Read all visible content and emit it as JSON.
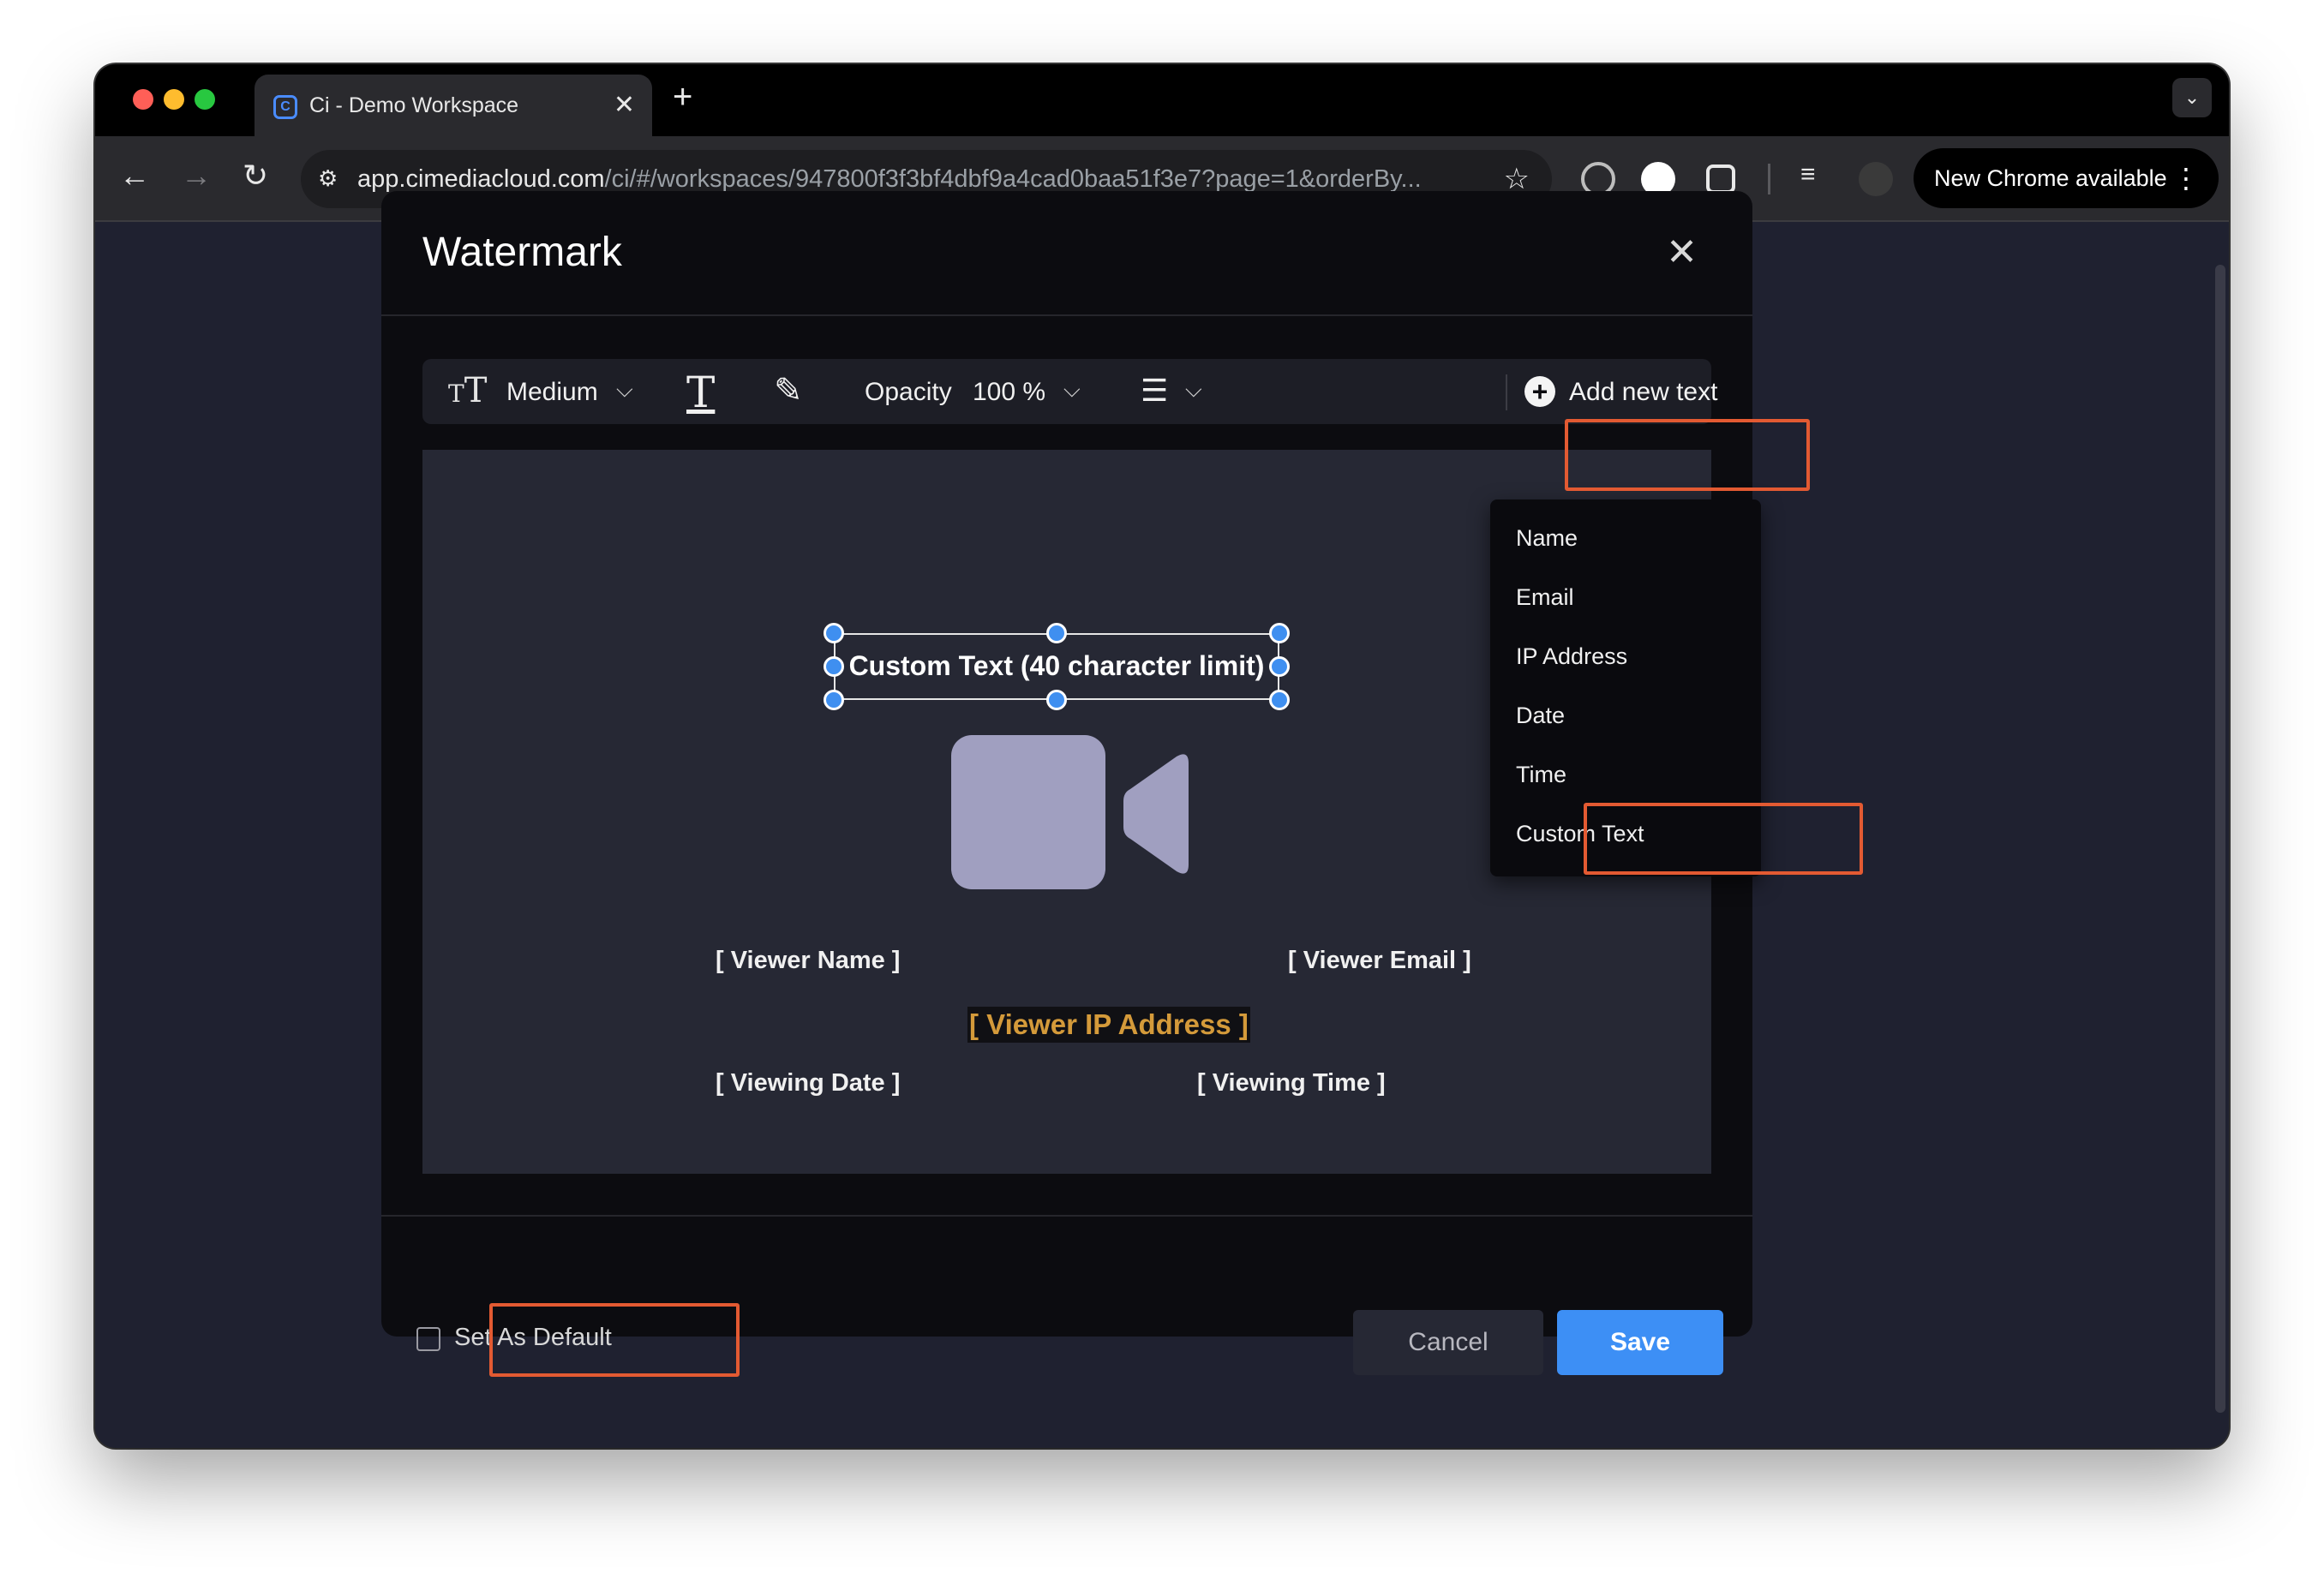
{
  "browser": {
    "tab_title": "Ci - Demo Workspace",
    "tab_close": "✕",
    "new_tab": "+",
    "url_host": "app.cimediacloud.com",
    "url_path": "/ci/#/workspaces/947800f3f3bf4dbf9a4cad0baa51f3e7?page=1&orderBy...",
    "update_chip": "New Chrome available"
  },
  "modal": {
    "title": "Watermark",
    "close": "✕"
  },
  "toolbar": {
    "size_value": "Medium",
    "opacity_label": "Opacity",
    "opacity_value": "100 %",
    "add_text": "Add new text"
  },
  "canvas": {
    "custom_text": "Custom Text (40 character limit)",
    "viewer_name": "[ Viewer Name ]",
    "viewer_email": "[ Viewer Email ]",
    "viewer_ip": "[ Viewer IP Address ]",
    "viewing_date": "[ Viewing Date ]",
    "viewing_time": "[ Viewing Time ]"
  },
  "dropdown": {
    "items": [
      "Name",
      "Email",
      "IP Address",
      "Date",
      "Time",
      "Custom Text"
    ]
  },
  "footer": {
    "set_default": "Set As Default",
    "cancel": "Cancel",
    "save": "Save"
  },
  "colors": {
    "accent_blue": "#3d8ff5",
    "highlight_orange": "#e35a32",
    "ip_text": "#d49a3a"
  }
}
